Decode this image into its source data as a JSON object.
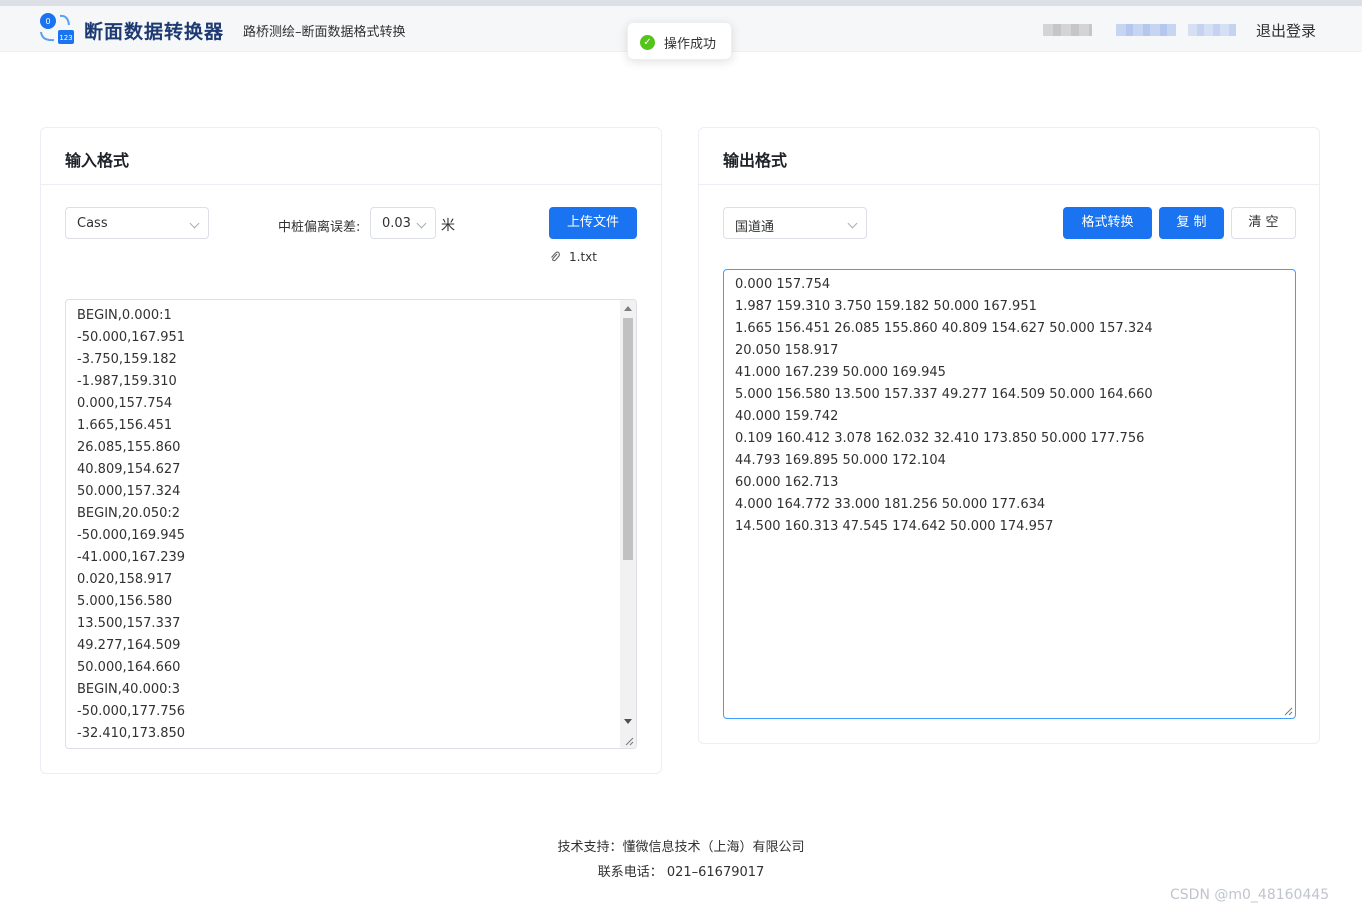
{
  "header": {
    "app_title": "断面数据转换器",
    "app_subtitle": "路桥测绘–断面数据格式转换",
    "logout_label": "退出登录",
    "logo_numbers": [
      "0",
      "123"
    ]
  },
  "toast": {
    "message": "操作成功"
  },
  "input_panel": {
    "title": "输入格式",
    "format_select": "Cass",
    "offset_label": "中桩偏离误差:",
    "offset_select": "0.03",
    "offset_unit": "米",
    "upload_button": "上传文件",
    "uploaded_file": "1.txt",
    "lines": [
      "BEGIN,0.000:1",
      "-50.000,167.951",
      "-3.750,159.182",
      "-1.987,159.310",
      "0.000,157.754",
      "1.665,156.451",
      "26.085,155.860",
      "40.809,154.627",
      "50.000,157.324",
      "BEGIN,20.050:2",
      "-50.000,169.945",
      "-41.000,167.239",
      "0.020,158.917",
      "5.000,156.580",
      "13.500,157.337",
      "49.277,164.509",
      "50.000,164.660",
      "BEGIN,40.000:3",
      "-50.000,177.756",
      "-32.410,173.850"
    ]
  },
  "output_panel": {
    "title": "输出格式",
    "format_select": "国道通",
    "convert_button": "格式转换",
    "copy_button": "复 制",
    "clear_button": "清 空",
    "lines": [
      "0.000 157.754",
      "1.987 159.310 3.750 159.182 50.000 167.951",
      "1.665 156.451 26.085 155.860 40.809 154.627 50.000 157.324",
      "20.050 158.917",
      "41.000 167.239 50.000 169.945",
      "5.000 156.580 13.500 157.337 49.277 164.509 50.000 164.660",
      "40.000 159.742",
      "0.109 160.412 3.078 162.032 32.410 173.850 50.000 177.756",
      "44.793 169.895 50.000 172.104",
      "60.000 162.713",
      "4.000 164.772 33.000 181.256 50.000 177.634",
      "14.500 160.313 47.545 174.642 50.000 174.957"
    ]
  },
  "footer": {
    "support": "技术支持：懂微信息技术（上海）有限公司",
    "phone": "联系电话： 021–61679017"
  },
  "watermark": "CSDN @m0_48160445",
  "colors": {
    "primary": "#1a73f0",
    "title_blue": "#1e3a72",
    "success": "#52c41a",
    "focus_border": "#409eff"
  }
}
